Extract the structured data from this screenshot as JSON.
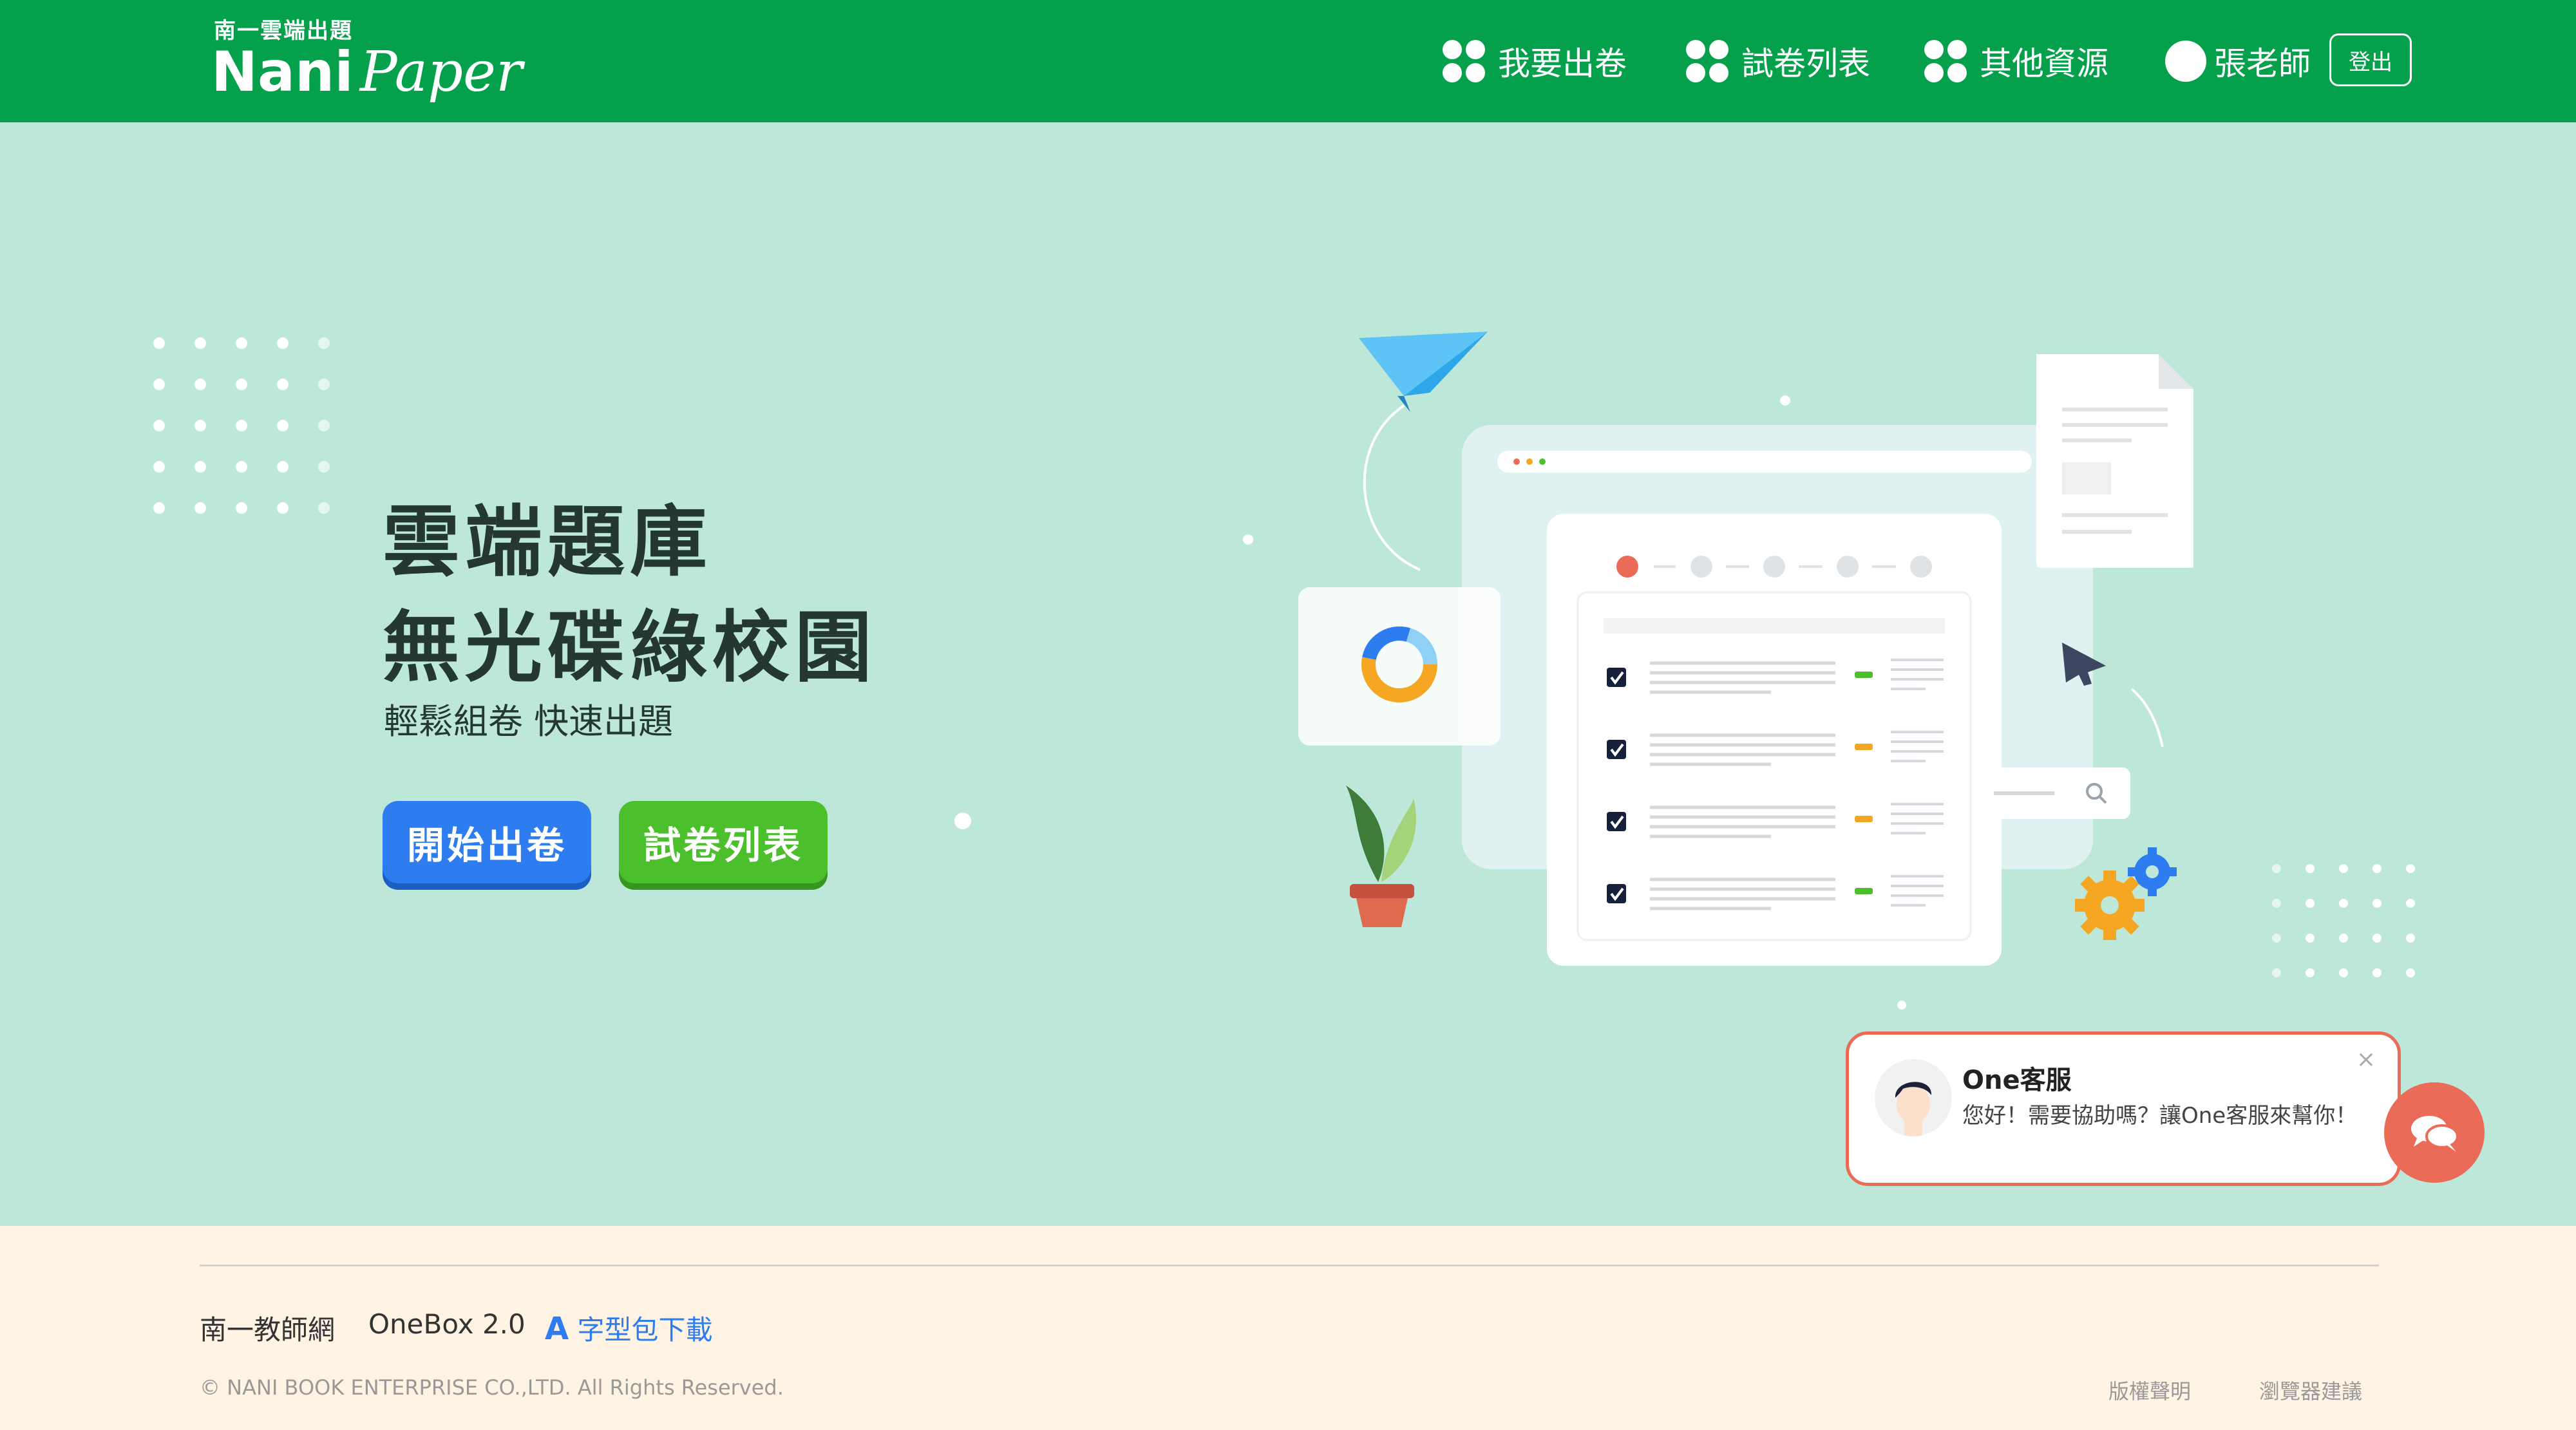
{
  "header": {
    "logo_sub": "南一雲端出題",
    "logo_main": "Nani",
    "logo_main_italic": "Paper",
    "nav": [
      "我要出卷",
      "試卷列表",
      "其他資源"
    ],
    "user_name": "張老師",
    "logout_label": "登出",
    "bg_color": "#05a04c"
  },
  "hero": {
    "title_line1": "雲端題庫",
    "title_line2": "無光碟綠校園",
    "subtitle": "輕鬆組卷 快速出題",
    "btn_start": "開始出卷",
    "btn_list": "試卷列表",
    "bg_color": "#bde7d9"
  },
  "chat": {
    "name": "One客服",
    "message": "您好！需要協助嗎？讓One客服來幫你！",
    "close": "×"
  },
  "footer": {
    "links": [
      "南一教師網",
      "OneBox 2.0",
      "字型包下載"
    ],
    "font_icon": "A",
    "copyright": "© NANI BOOK ENTERPRISE CO.,LTD. All Rights Reserved.",
    "right_links": [
      "版權聲明",
      "瀏覽器建議"
    ]
  }
}
